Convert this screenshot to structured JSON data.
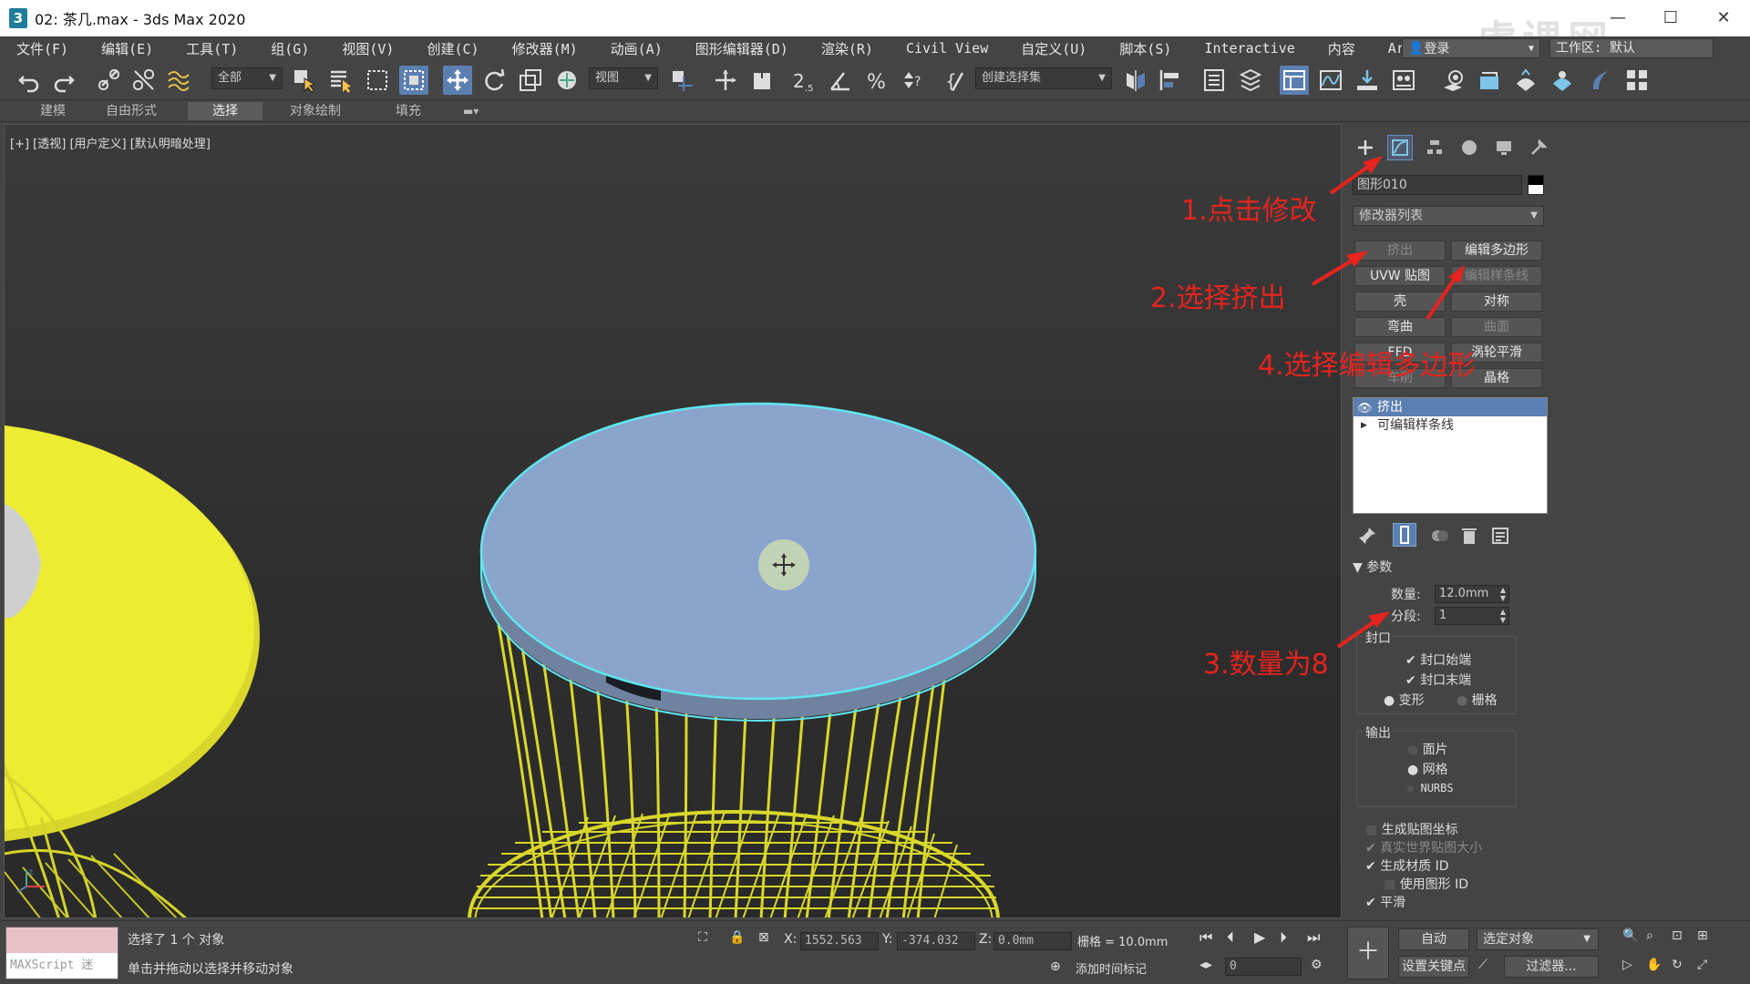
{
  "window": {
    "title": "02: 茶几.max - 3ds Max 2020",
    "app_icon": "3",
    "controls": [
      "—",
      "☐",
      "✕"
    ]
  },
  "menu": {
    "items": [
      "文件(F)",
      "编辑(E)",
      "工具(T)",
      "组(G)",
      "视图(V)",
      "创建(C)",
      "修改器(M)",
      "动画(A)",
      "图形编辑器(D)",
      "渲染(R)",
      "Civil View",
      "自定义(U)",
      "脚本(S)",
      "Interactive",
      "内容",
      "Arnold"
    ],
    "more": "»",
    "login": "登录",
    "workspace": "工作区: 默认"
  },
  "toolbar": {
    "selection_filter": "全部",
    "reference_coord": "视图",
    "named_selection": "创建选择集"
  },
  "ribbon": {
    "tabs": [
      "建模",
      "自由形式",
      "选择",
      "对象绘制",
      "填充"
    ],
    "selected_tab": "选择"
  },
  "viewport": {
    "label": "[+] [透视] [用户定义] [默认明暗处理]"
  },
  "command_panel": {
    "object_name": "图形010",
    "modifier_list": "修改器列表",
    "modifier_buttons": [
      {
        "label": "挤出",
        "enabled": false
      },
      {
        "label": "编辑多边形",
        "enabled": true
      },
      {
        "label": "UVW 贴图",
        "enabled": true
      },
      {
        "label": "编辑样条线",
        "enabled": false
      },
      {
        "label": "壳",
        "enabled": true
      },
      {
        "label": "对称",
        "enabled": true
      },
      {
        "label": "弯曲",
        "enabled": true
      },
      {
        "label": "曲面",
        "enabled": false
      },
      {
        "label": "FFD",
        "enabled": true
      },
      {
        "label": "涡轮平滑",
        "enabled": true
      },
      {
        "label": "车削",
        "enabled": false
      },
      {
        "label": "晶格",
        "enabled": true
      }
    ],
    "stack": [
      {
        "label": "挤出",
        "selected": true
      },
      {
        "label": "可编辑样条线",
        "selected": false
      }
    ],
    "params": {
      "header": "参数",
      "amount_label": "数量:",
      "amount_value": "12.0mm",
      "segments_label": "分段:",
      "segments_value": "1",
      "capping_label": "封口",
      "cap_start": "封口始端",
      "cap_end": "封口末端",
      "morph": "变形",
      "grid": "栅格",
      "output_label": "输出",
      "patch": "面片",
      "mesh": "网格",
      "nurbs": "NURBS",
      "gen_map": "生成贴图坐标",
      "real_world": "真实世界贴图大小",
      "gen_matid": "生成材质 ID",
      "use_shape_id": "使用图形 ID",
      "smooth": "平滑"
    }
  },
  "annotations": {
    "a1": "1.点击修改",
    "a2": "2.选择挤出",
    "a3": "3.数量为8",
    "a4": "4.选择编辑多边形"
  },
  "status": {
    "maxscript": "MAXScript 迷",
    "selected": "选择了 1 个 对象",
    "prompt": "单击并拖动以选择并移动对象",
    "x_label": "X:",
    "x": "1552.563",
    "y_label": "Y:",
    "y": "-374.032",
    "z_label": "Z:",
    "z": "0.0mm",
    "grid": "栅格 = 10.0mm",
    "add_time_tag": "添加时间标记",
    "frame": "0",
    "auto": "自动",
    "selected_obj": "选定对象",
    "set_key": "设置关键点",
    "filters": "过滤器..."
  },
  "watermark": "虎课网"
}
